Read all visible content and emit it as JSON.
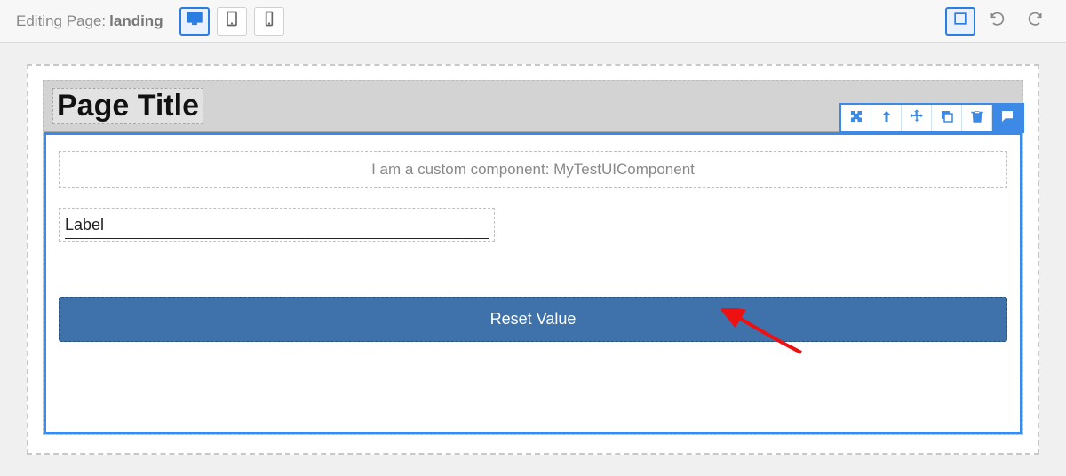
{
  "toolbar": {
    "editing_prefix": "Editing Page:",
    "page_name": "landing"
  },
  "page": {
    "title": "Page Title",
    "component_banner": "I am a custom component: MyTestUIComponent",
    "label_field": "Label",
    "reset_button": "Reset Value"
  },
  "colors": {
    "accent": "#3c8ae6",
    "button_bg": "#3f72aa"
  }
}
